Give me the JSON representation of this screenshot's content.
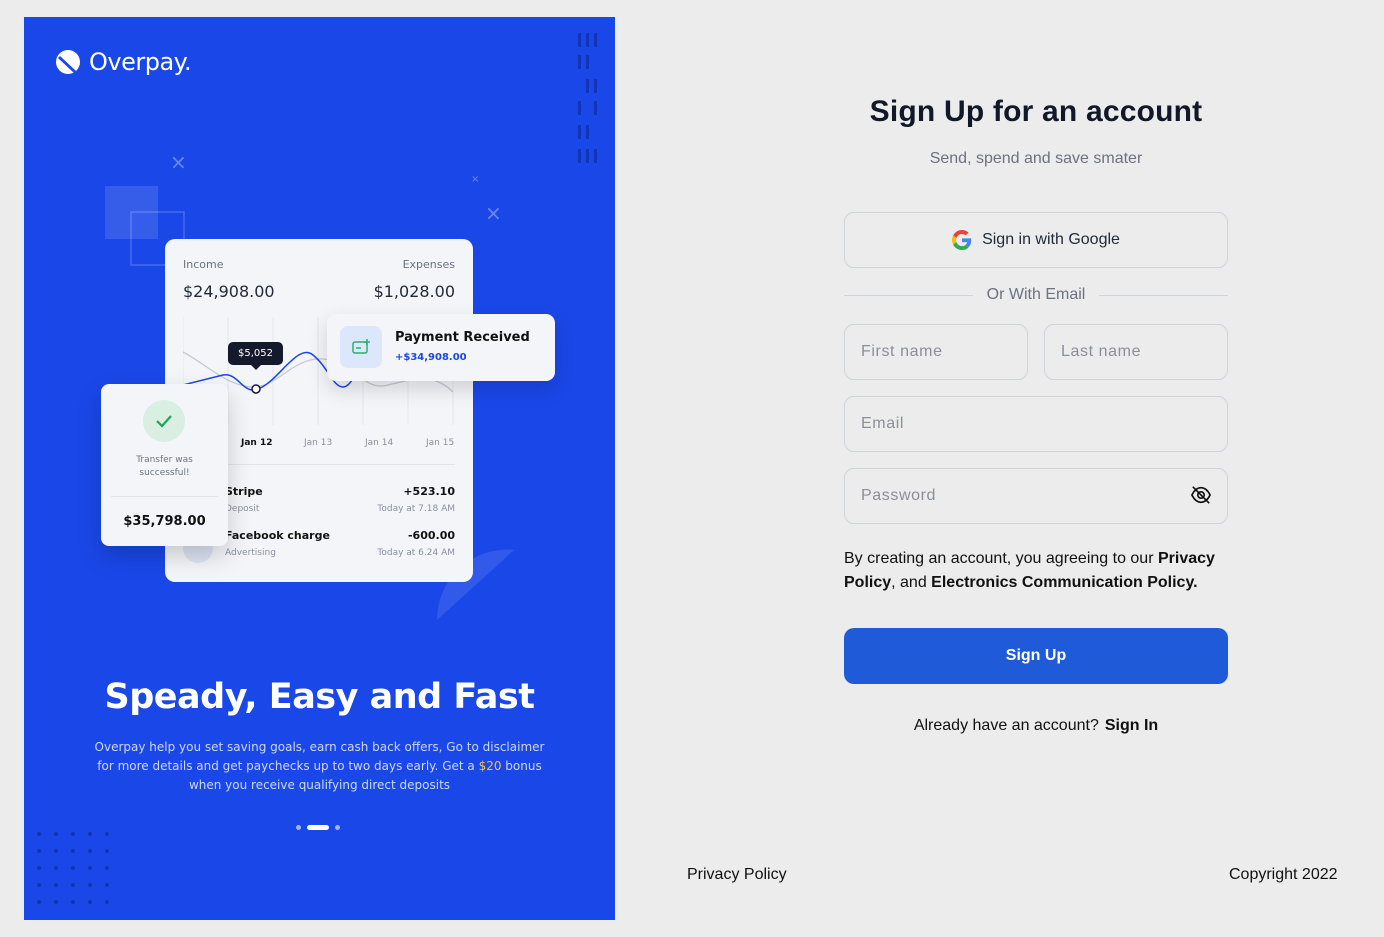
{
  "brand": {
    "name": "Overpay."
  },
  "dashboard": {
    "income_label": "Income",
    "income_value": "$24,908.00",
    "expenses_label": "Expenses",
    "expenses_value": "$1,028.00",
    "tooltip_value": "$5,052",
    "ticks": [
      "Jan 12",
      "Jan 13",
      "Jan 14",
      "Jan 15"
    ],
    "transactions": [
      {
        "name": "Stripe",
        "sub": "Deposit",
        "amount": "+523.10",
        "time": "Today at 7.18 AM"
      },
      {
        "name": "Facebook charge",
        "sub": "Advertising",
        "amount": "-600.00",
        "time": "Today at 6.24 AM"
      }
    ]
  },
  "payment_card": {
    "title": "Payment Received",
    "amount": "+$34,908.00"
  },
  "transfer_card": {
    "text": "Transfer was successful!",
    "amount": "$35,798.00"
  },
  "promo": {
    "headline": "Speady, Easy and Fast",
    "body_before": "Overpay help you set saving goals, earn cash back offers, Go to disclaimer for more details and get paychecks up to two days early. Get a ",
    "body_highlight": "$20",
    "body_after": " bonus when you receive qualifying direct deposits",
    "carousel_active_index": 1,
    "carousel_count": 3
  },
  "form": {
    "title": "Sign Up for an account",
    "subtitle": "Send, spend and save smater",
    "google_label": "Sign in with Google",
    "divider_label": "Or With Email",
    "first_name_placeholder": "First name",
    "last_name_placeholder": "Last name",
    "email_placeholder": "Email",
    "password_placeholder": "Password",
    "terms_prefix": "By creating an account, you agreeing to our ",
    "terms_link1": "Privacy Policy",
    "terms_mid": ", and ",
    "terms_link2": "Electronics Communication Policy.",
    "submit_label": "Sign Up",
    "already_text": "Already have an account?",
    "signin_label": "Sign In"
  },
  "footer": {
    "privacy": "Privacy Policy",
    "copyright": "Copyright 2022"
  },
  "colors": {
    "brand_blue": "#1a47e8",
    "button_blue": "#1f5ad8",
    "highlight": "#f5c542"
  }
}
